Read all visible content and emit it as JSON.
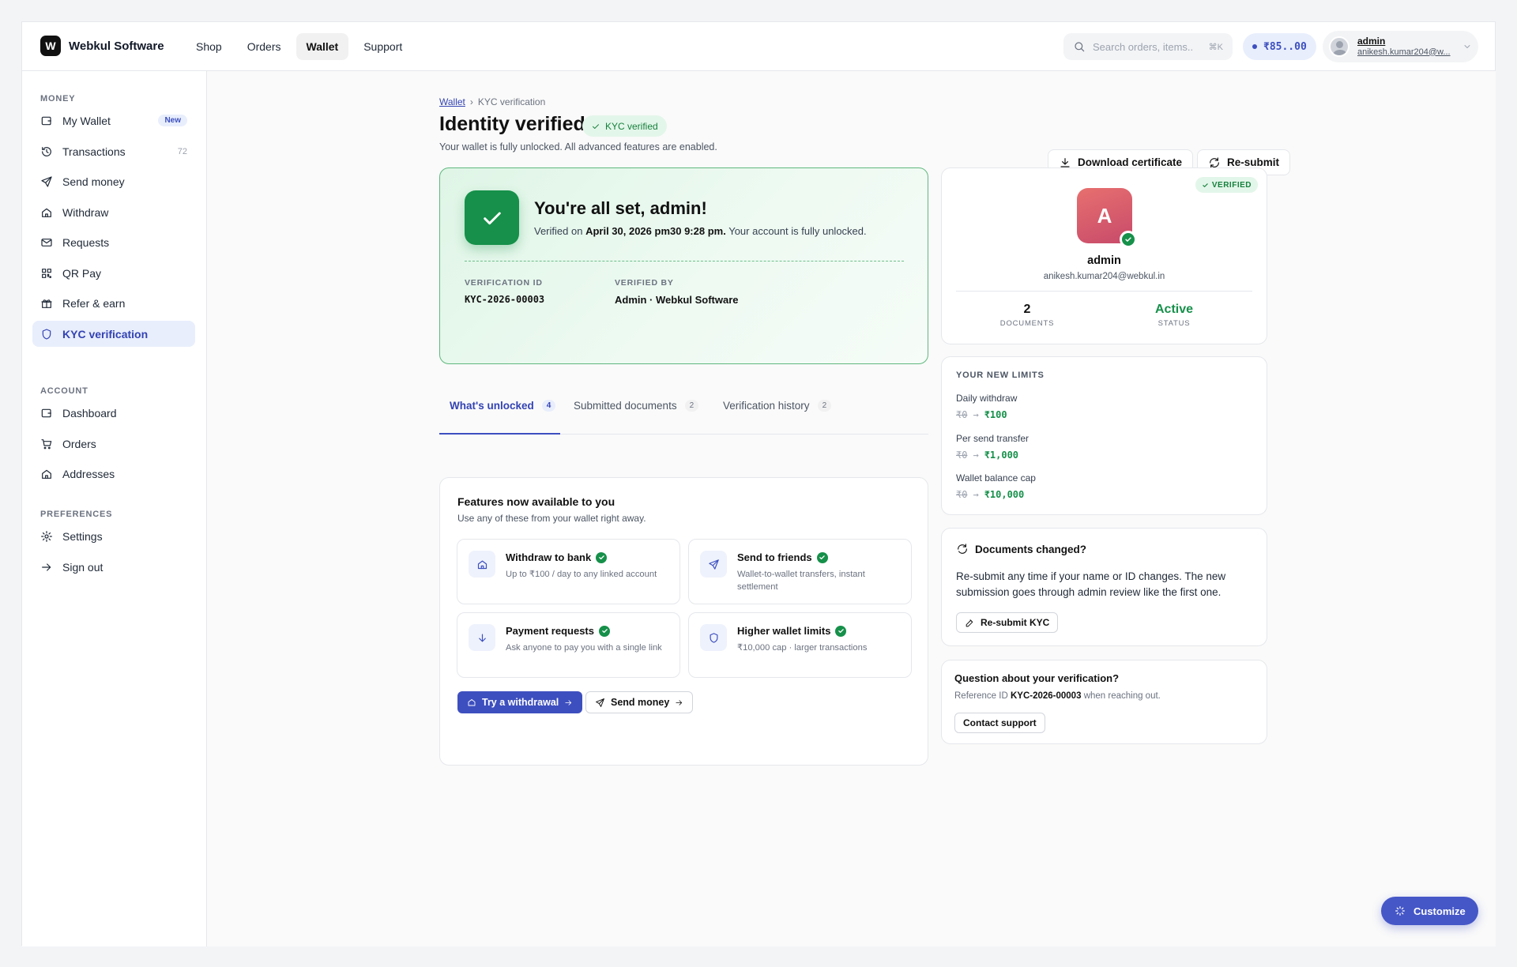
{
  "brand": {
    "logo_letter": "W",
    "name": "Webkul Software"
  },
  "topnav": [
    {
      "label": "Shop",
      "active": false
    },
    {
      "label": "Orders",
      "active": false
    },
    {
      "label": "Wallet",
      "active": true
    },
    {
      "label": "Support",
      "active": false
    }
  ],
  "search": {
    "placeholder": "Search orders, items..",
    "shortcut": "⌘K"
  },
  "balance": "₹85..00",
  "user": {
    "name": "admin",
    "email": "anikesh.kumar204@w..."
  },
  "sidebar": {
    "money_title": "MONEY",
    "money": [
      {
        "label": "My Wallet",
        "icon": "wallet-icon",
        "badge": "New"
      },
      {
        "label": "Transactions",
        "icon": "history-icon",
        "count": "72"
      },
      {
        "label": "Send money",
        "icon": "send-icon"
      },
      {
        "label": "Withdraw",
        "icon": "home-icon"
      },
      {
        "label": "Requests",
        "icon": "mail-icon"
      },
      {
        "label": "QR Pay",
        "icon": "qr-icon"
      },
      {
        "label": "Refer & earn",
        "icon": "gift-icon"
      },
      {
        "label": "KYC verification",
        "icon": "shield-icon",
        "active": true
      }
    ],
    "account_title": "ACCOUNT",
    "account": [
      {
        "label": "Dashboard",
        "icon": "dashboard-icon"
      },
      {
        "label": "Orders",
        "icon": "cart-icon"
      },
      {
        "label": "Addresses",
        "icon": "home-icon"
      }
    ],
    "prefs_title": "PREFERENCES",
    "prefs": [
      {
        "label": "Settings",
        "icon": "gear-icon"
      },
      {
        "label": "Sign out",
        "icon": "arrow-right-icon"
      }
    ]
  },
  "breadcrumb": {
    "parent": "Wallet",
    "separator": "›",
    "current": "KYC verification"
  },
  "page": {
    "title": "Identity verified",
    "badge": "KYC verified",
    "subtitle": "Your wallet is fully unlocked. All advanced features are enabled.",
    "download_label": "Download certificate",
    "resubmit_label": "Re-submit"
  },
  "hero": {
    "title": "You're all set, admin!",
    "verified_prefix": "Verified on",
    "verified_date": "April 30, 2026 pm30 9:28 pm.",
    "verified_suffix": "Your account is fully unlocked.",
    "id_label": "VERIFICATION ID",
    "id_value": "KYC-2026-00003",
    "by_label": "VERIFIED BY",
    "by_value": "Admin · Webkul Software"
  },
  "tabs": [
    {
      "label": "What's unlocked",
      "count": "4",
      "active": true
    },
    {
      "label": "Submitted documents",
      "count": "2",
      "active": false
    },
    {
      "label": "Verification history",
      "count": "2",
      "active": false
    }
  ],
  "features": {
    "title": "Features now available to you",
    "subtitle": "Use any of these from your wallet right away.",
    "items": [
      {
        "title": "Withdraw to bank",
        "desc": "Up to ₹100 / day to any linked account",
        "icon": "bank-icon"
      },
      {
        "title": "Send to friends",
        "desc": "Wallet-to-wallet transfers, instant settlement",
        "icon": "send-icon"
      },
      {
        "title": "Payment requests",
        "desc": "Ask anyone to pay you with a single link",
        "icon": "arrow-down-icon"
      },
      {
        "title": "Higher wallet limits",
        "desc": "₹10,000 cap · larger transactions",
        "icon": "shield-icon"
      }
    ],
    "primary_label": "Try a withdrawal",
    "secondary_label": "Send money"
  },
  "profile": {
    "verified": "VERIFIED",
    "initial": "A",
    "name": "admin",
    "email": "anikesh.kumar204@webkul.in",
    "documents_value": "2",
    "documents_label": "DOCUMENTS",
    "status_value": "Active",
    "status_label": "STATUS"
  },
  "limits": {
    "title": "YOUR NEW LIMITS",
    "items": [
      {
        "label": "Daily withdraw",
        "old": "₹0",
        "arrow": "→",
        "new": "₹100"
      },
      {
        "label": "Per send transfer",
        "old": "₹0",
        "arrow": "→",
        "new": "₹1,000"
      },
      {
        "label": "Wallet balance cap",
        "old": "₹0",
        "arrow": "→",
        "new": "₹10,000"
      }
    ]
  },
  "docs_changed": {
    "title": "Documents changed?",
    "body": "Re-submit any time if your name or ID changes. The new submission goes through admin review like the first one.",
    "button": "Re-submit KYC"
  },
  "question": {
    "title": "Question about your verification?",
    "ref_prefix": "Reference ID",
    "ref_id": "KYC-2026-00003",
    "ref_suffix": "when reaching out.",
    "button": "Contact support"
  },
  "customize_label": "Customize",
  "colors": {
    "accent": "#3d4fbf",
    "success": "#16904a",
    "hero_border": "#5fb87e"
  }
}
